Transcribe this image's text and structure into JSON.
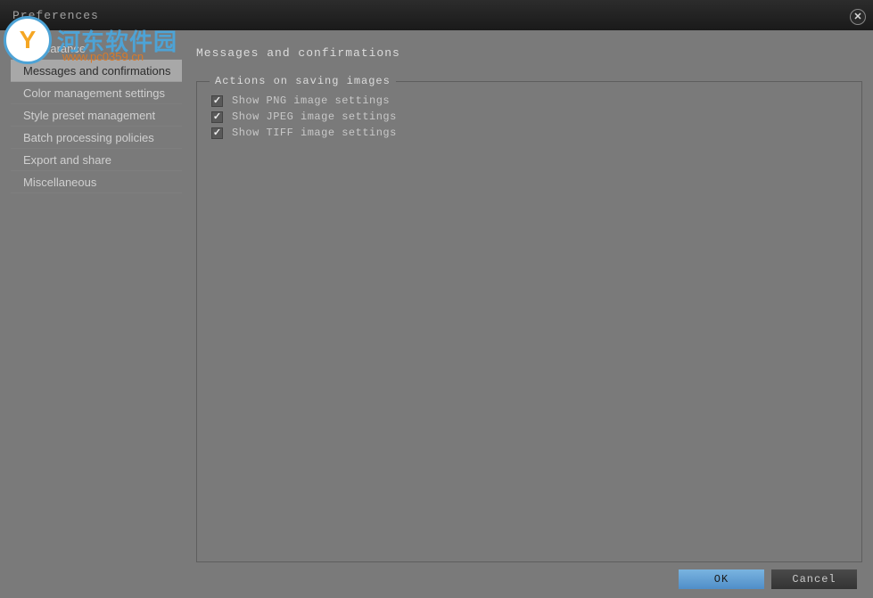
{
  "window": {
    "title": "Preferences"
  },
  "watermark": {
    "text": "河东软件园",
    "url": "www.pc0359.cn"
  },
  "sidebar": {
    "items": [
      {
        "label": "Appearance",
        "active": false
      },
      {
        "label": "Messages and confirmations",
        "active": true
      },
      {
        "label": "Color management settings",
        "active": false
      },
      {
        "label": "Style preset management",
        "active": false
      },
      {
        "label": "Batch processing policies",
        "active": false
      },
      {
        "label": "Export and share",
        "active": false
      },
      {
        "label": "Miscellaneous",
        "active": false
      }
    ]
  },
  "content": {
    "title": "Messages and confirmations",
    "fieldset": {
      "legend": "Actions on saving images",
      "checkboxes": [
        {
          "label": "Show PNG image settings",
          "checked": true
        },
        {
          "label": "Show JPEG image settings",
          "checked": true
        },
        {
          "label": "Show TIFF image settings",
          "checked": true
        }
      ]
    }
  },
  "buttons": {
    "ok": "OK",
    "cancel": "Cancel"
  }
}
